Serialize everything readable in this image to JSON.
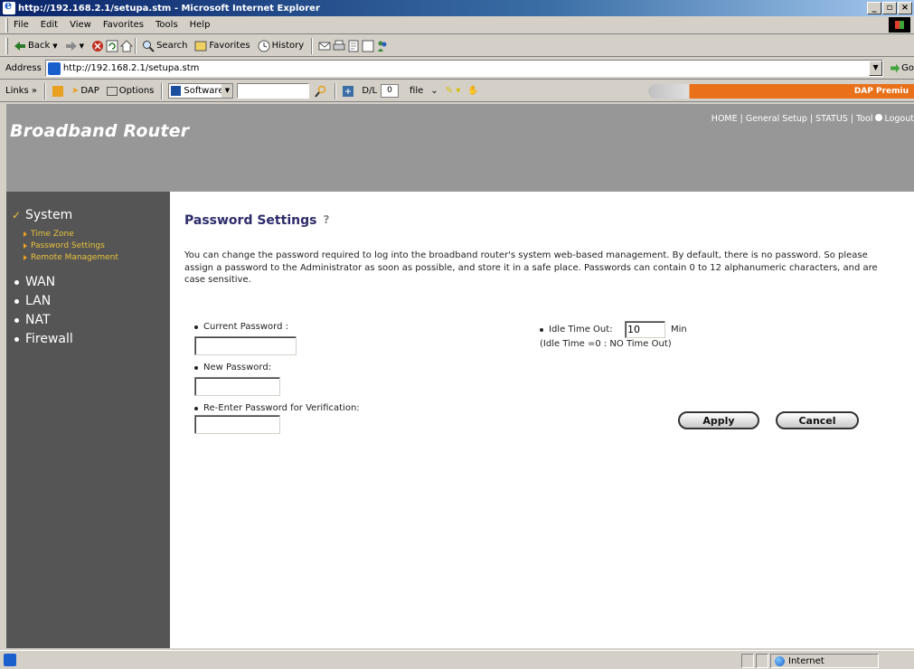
{
  "window": {
    "title": "http://192.168.2.1/setupa.stm - Microsoft Internet Explorer",
    "controls": [
      "_",
      "▫",
      "×"
    ]
  },
  "menubar": {
    "items": [
      "File",
      "Edit",
      "View",
      "Favorites",
      "Tools",
      "Help"
    ]
  },
  "toolbar": {
    "back": "Back",
    "search": "Search",
    "favorites": "Favorites",
    "history": "History"
  },
  "addressbar": {
    "label": "Address",
    "url": "http://192.168.2.1/setupa.stm",
    "go": "Go"
  },
  "linksbar": {
    "links": "Links »",
    "dap": "DAP",
    "options": "Options",
    "software": "Software",
    "dl": "D/L",
    "dl_count": "0",
    "file": "file",
    "dap_premium": "DAP Premiu"
  },
  "header": {
    "brand": "Broadband Router",
    "nav": {
      "home": "HOME",
      "general_setup": "General Setup",
      "status": "STATUS",
      "tool": "Tool",
      "logout": "Logout"
    }
  },
  "sidebar": {
    "system": "System",
    "system_items": [
      "Time Zone",
      "Password Settings",
      "Remote Management"
    ],
    "wan": "WAN",
    "lan": "LAN",
    "nat": "NAT",
    "firewall": "Firewall"
  },
  "content": {
    "title": "Password Settings",
    "description": "You can change the password required to log into the broadband router's system web-based management. By default, there is no password. So please assign a password to the Administrator as soon as possible, and store it in a safe place. Passwords can contain 0 to 12 alphanumeric characters, and are case sensitive.",
    "current_password_label": "Current Password :",
    "current_password_value": "",
    "new_password_label": "New Password:",
    "new_password_value": "",
    "reenter_label": "Re-Enter Password for Verification:",
    "reenter_value": "",
    "idle_label": "Idle Time Out:",
    "idle_value": "10",
    "idle_unit": "Min",
    "idle_note": "(Idle Time =0 : NO Time Out)",
    "apply": "Apply",
    "cancel": "Cancel"
  },
  "statusbar": {
    "zone": "Internet"
  }
}
